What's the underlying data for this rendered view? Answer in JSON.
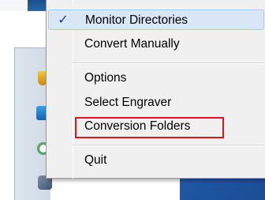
{
  "menu": {
    "items": [
      {
        "label": "Monitor Directories",
        "checked": true
      },
      {
        "label": "Convert Manually"
      },
      {
        "label": "Options"
      },
      {
        "label": "Select Engraver"
      },
      {
        "label": "Conversion Folders",
        "highlighted": true
      },
      {
        "label": "Quit"
      }
    ],
    "check_glyph": "✓"
  },
  "colors": {
    "menu_bg": "#f0f0f0",
    "highlight_border": "#e0141c",
    "checked_bg": "#d8e6f6",
    "desktop_blue": "#1f5aa8"
  },
  "icons": [
    "shield-icon",
    "app-blue-icon",
    "green-circle-icon",
    "engraver-icon"
  ]
}
